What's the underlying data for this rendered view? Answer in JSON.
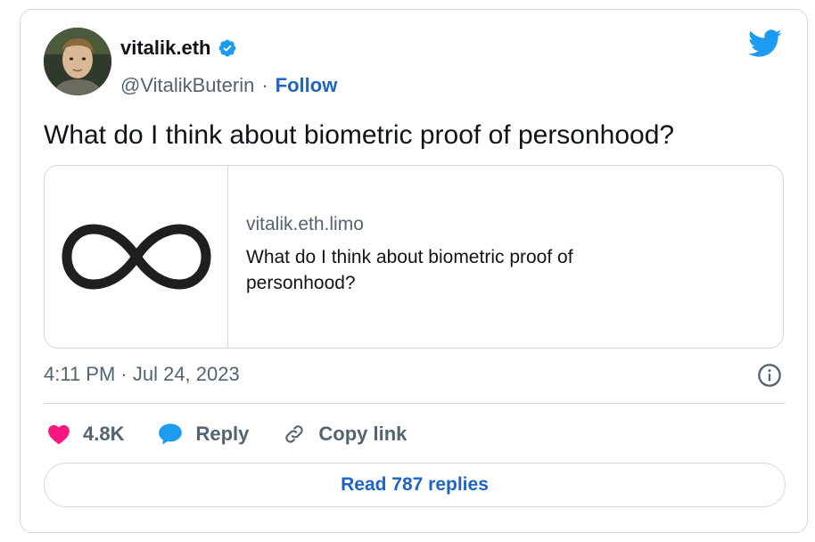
{
  "author": {
    "display_name": "vitalik.eth",
    "handle": "@VitalikButerin",
    "separator": "·",
    "follow_label": "Follow",
    "verified": true
  },
  "tweet": {
    "text": "What do I think about biometric proof of personhood?",
    "timestamp": "4:11 PM · Jul 24, 2023"
  },
  "link_card": {
    "domain": "vitalik.eth.limo",
    "title": "What do I think about biometric proof of personhood?",
    "thumbnail_icon": "infinity-icon"
  },
  "actions": {
    "like_count": "4.8K",
    "reply_label": "Reply",
    "copy_link_label": "Copy link"
  },
  "read_replies_label": "Read 787 replies",
  "colors": {
    "accent": "#1d9bf0",
    "link": "#1d64c4",
    "like": "#f91880",
    "muted": "#536471",
    "border": "#cfd9de",
    "text": "#0f1419"
  }
}
